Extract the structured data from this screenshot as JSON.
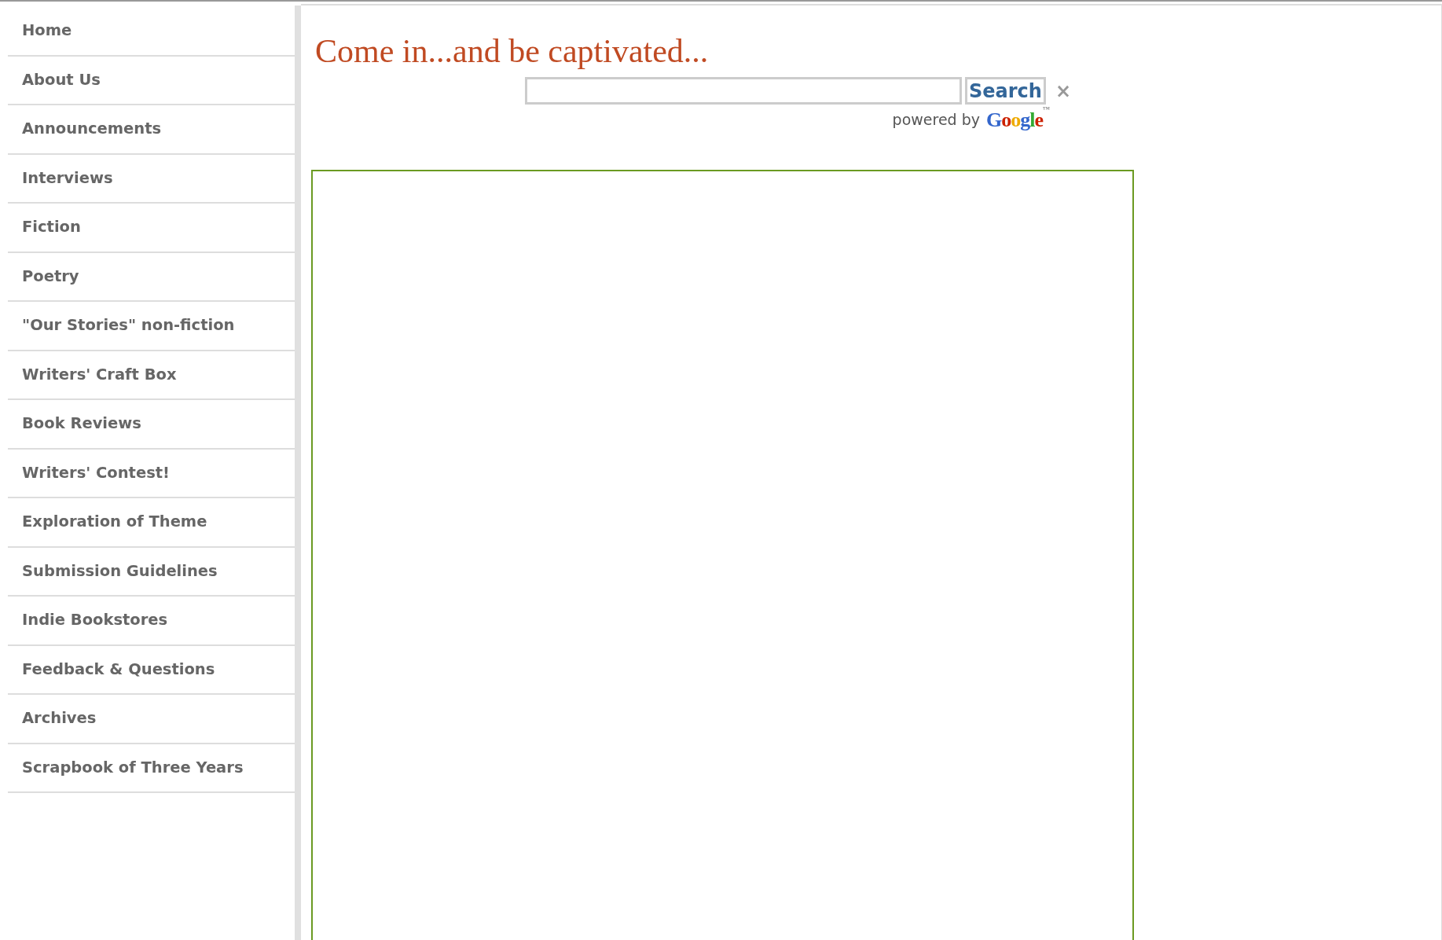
{
  "sidebar": {
    "items": [
      {
        "label": "Home"
      },
      {
        "label": "About Us"
      },
      {
        "label": "Announcements"
      },
      {
        "label": "Interviews"
      },
      {
        "label": "Fiction"
      },
      {
        "label": "Poetry"
      },
      {
        "label": "\"Our Stories\" non-fiction"
      },
      {
        "label": "Writers' Craft Box"
      },
      {
        "label": "Book Reviews"
      },
      {
        "label": "Writers' Contest!"
      },
      {
        "label": "Exploration of Theme"
      },
      {
        "label": "Submission Guidelines"
      },
      {
        "label": "Indie Bookstores"
      },
      {
        "label": "Feedback & Questions"
      },
      {
        "label": "Archives"
      },
      {
        "label": "Scrapbook of Three Years"
      }
    ]
  },
  "heading": "Come in...and be captivated...",
  "search": {
    "button": "Search",
    "clear": "×",
    "powered_by": "powered by",
    "logo": "Google",
    "logo_mark": "™"
  }
}
